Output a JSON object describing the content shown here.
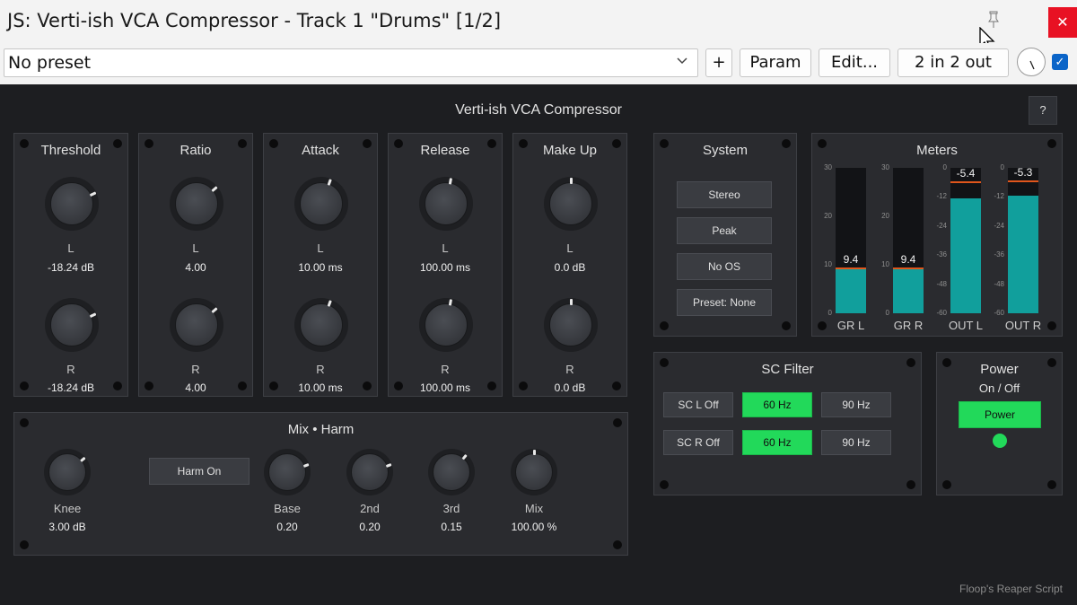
{
  "window": {
    "title": "JS: Verti-ish VCA Compressor - Track 1 \"Drums\" [1/2]",
    "close_glyph": "✕",
    "pin_icon": "pin-icon"
  },
  "toolbar": {
    "preset_value": "No preset",
    "add_label": "+",
    "param_label": "Param",
    "edit_label": "Edit...",
    "io_label": "2 in 2 out",
    "checkbox_glyph": "✓"
  },
  "plugin": {
    "title": "Verti-ish VCA Compressor",
    "help_label": "?",
    "credit": "Floop's Reaper Script",
    "channel_labels": {
      "left": "L",
      "right": "R"
    },
    "controls": [
      {
        "title": "Threshold",
        "left_value": "-18.24 dB",
        "right_value": "-18.24 dB"
      },
      {
        "title": "Ratio",
        "left_value": "4.00",
        "right_value": "4.00"
      },
      {
        "title": "Attack",
        "left_value": "10.00 ms",
        "right_value": "10.00 ms"
      },
      {
        "title": "Release",
        "left_value": "100.00 ms",
        "right_value": "100.00 ms"
      },
      {
        "title": "Make Up",
        "left_value": "0.0 dB",
        "right_value": "0.0 dB"
      }
    ],
    "system": {
      "title": "System",
      "buttons": [
        "Stereo",
        "Peak",
        "No OS",
        "Preset: None"
      ]
    },
    "meters": {
      "title": "Meters",
      "gr_scale": [
        "30",
        "20",
        "10",
        "0"
      ],
      "out_scale": [
        "0",
        "-12",
        "-24",
        "-36",
        "-48",
        "-60"
      ],
      "channels": [
        {
          "label": "GR L",
          "readout": "9.4",
          "level": 9.4,
          "range": [
            0,
            30
          ]
        },
        {
          "label": "GR R",
          "readout": "9.4",
          "level": 9.4,
          "range": [
            0,
            30
          ]
        },
        {
          "label": "OUT L",
          "readout": "-5.4",
          "level": -12.5,
          "peak": -5.4,
          "range": [
            -60,
            0
          ]
        },
        {
          "label": "OUT R",
          "readout": "-5.3",
          "level": -11.5,
          "peak": -5.3,
          "range": [
            -60,
            0
          ]
        }
      ]
    },
    "mix": {
      "title": "Mix • Harm",
      "harm_button": "Harm On",
      "knobs": [
        {
          "label": "Knee",
          "value": "3.00 dB"
        },
        {
          "label": "Base",
          "value": "0.20"
        },
        {
          "label": "2nd",
          "value": "0.20"
        },
        {
          "label": "3rd",
          "value": "0.15"
        },
        {
          "label": "Mix",
          "value": "100.00 %"
        }
      ]
    },
    "sc_filter": {
      "title": "SC Filter",
      "rows": [
        {
          "off_label": "SC L Off",
          "opt1": "60 Hz",
          "opt2": "90 Hz",
          "selected": "60 Hz"
        },
        {
          "off_label": "SC R Off",
          "opt1": "60 Hz",
          "opt2": "90 Hz",
          "selected": "60 Hz"
        }
      ]
    },
    "power": {
      "title": "Power",
      "subtitle": "On / Off",
      "button": "Power",
      "led_color": "#22d95a"
    }
  }
}
